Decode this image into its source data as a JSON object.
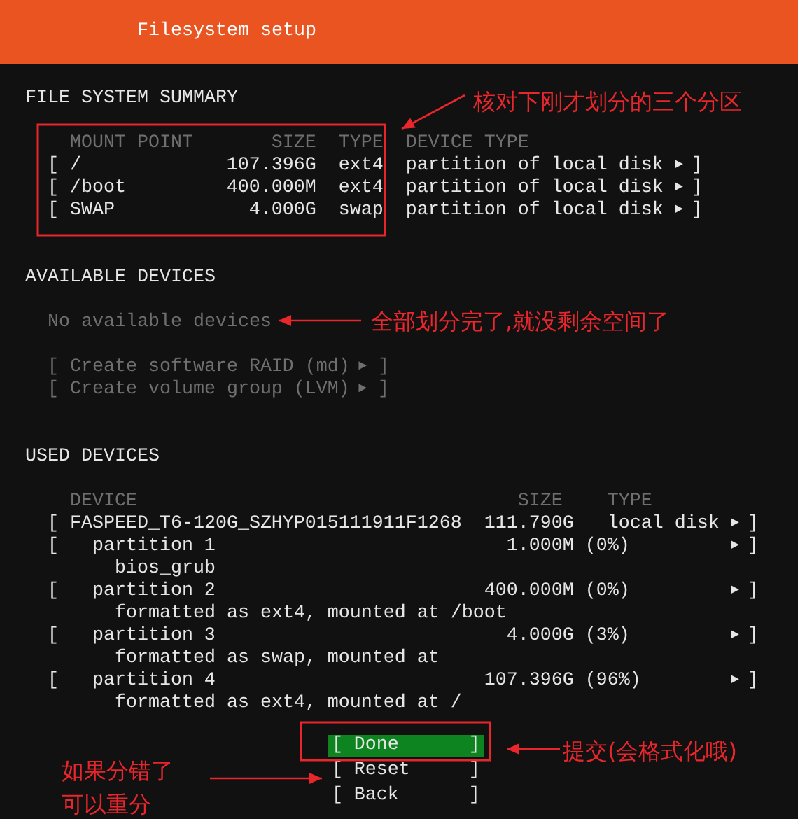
{
  "header": {
    "title": "Filesystem setup"
  },
  "summary": {
    "heading": "FILE SYSTEM SUMMARY",
    "columns": [
      "MOUNT POINT",
      "SIZE",
      "TYPE",
      "DEVICE TYPE"
    ],
    "rows": [
      {
        "open": "[",
        "mount_point": "/",
        "size": "107.396G",
        "type": "ext4",
        "device_type": "partition of local disk",
        "marker": "►",
        "close": "]"
      },
      {
        "open": "[",
        "mount_point": "/boot",
        "size": "400.000M",
        "type": "ext4",
        "device_type": "partition of local disk",
        "marker": "►",
        "close": "]"
      },
      {
        "open": "[",
        "mount_point": "SWAP",
        "size": "4.000G",
        "type": "swap",
        "device_type": "partition of local disk",
        "marker": "►",
        "close": "]"
      }
    ]
  },
  "available": {
    "heading": "AVAILABLE DEVICES",
    "empty_message": "No available devices",
    "actions": [
      {
        "open": "[",
        "label": "Create software RAID (md)",
        "marker": "►",
        "close": "]",
        "disabled": true
      },
      {
        "open": "[",
        "label": "Create volume group (LVM)",
        "marker": "►",
        "close": "]",
        "disabled": true
      }
    ]
  },
  "used": {
    "heading": "USED DEVICES",
    "columns": [
      "DEVICE",
      "SIZE",
      "TYPE"
    ],
    "rows": [
      {
        "kind": "disk",
        "open": "[",
        "name": "FASPEED_T6-120G_SZHYP015111911F1268",
        "size": "111.790G",
        "type": "local disk",
        "marker": "►",
        "close": "]",
        "children": [
          {
            "kind": "partition",
            "open": "[",
            "name": "partition 1",
            "size": "1.000M",
            "usage": "(0%)",
            "marker": "►",
            "close": "]",
            "detail": "bios_grub"
          },
          {
            "kind": "partition",
            "open": "[",
            "name": "partition 2",
            "size": "400.000M",
            "usage": "(0%)",
            "marker": "►",
            "close": "]",
            "detail": "formatted as ext4, mounted at /boot"
          },
          {
            "kind": "partition",
            "open": "[",
            "name": "partition 3",
            "size": "4.000G",
            "usage": "(3%)",
            "marker": "►",
            "close": "]",
            "detail": "formatted as swap, mounted at"
          },
          {
            "kind": "partition",
            "open": "[",
            "name": "partition 4",
            "size": "107.396G",
            "usage": "(96%)",
            "marker": "►",
            "close": "]",
            "detail": "formatted as ext4, mounted at /"
          }
        ]
      }
    ]
  },
  "buttons": [
    {
      "open": "[",
      "label": "Done",
      "close": "]",
      "selected": true
    },
    {
      "open": "[",
      "label": "Reset",
      "close": "]",
      "selected": false
    },
    {
      "open": "[",
      "label": "Back",
      "close": "]",
      "selected": false
    }
  ],
  "annotations": [
    {
      "lines": [
        "核对下刚才划分的三个分区"
      ]
    },
    {
      "lines": [
        "全部划分完了,就没剩余空间了"
      ]
    },
    {
      "lines": [
        "提交(会格式化哦)"
      ]
    },
    {
      "lines": [
        "如果分错了",
        "可以重分"
      ]
    }
  ]
}
